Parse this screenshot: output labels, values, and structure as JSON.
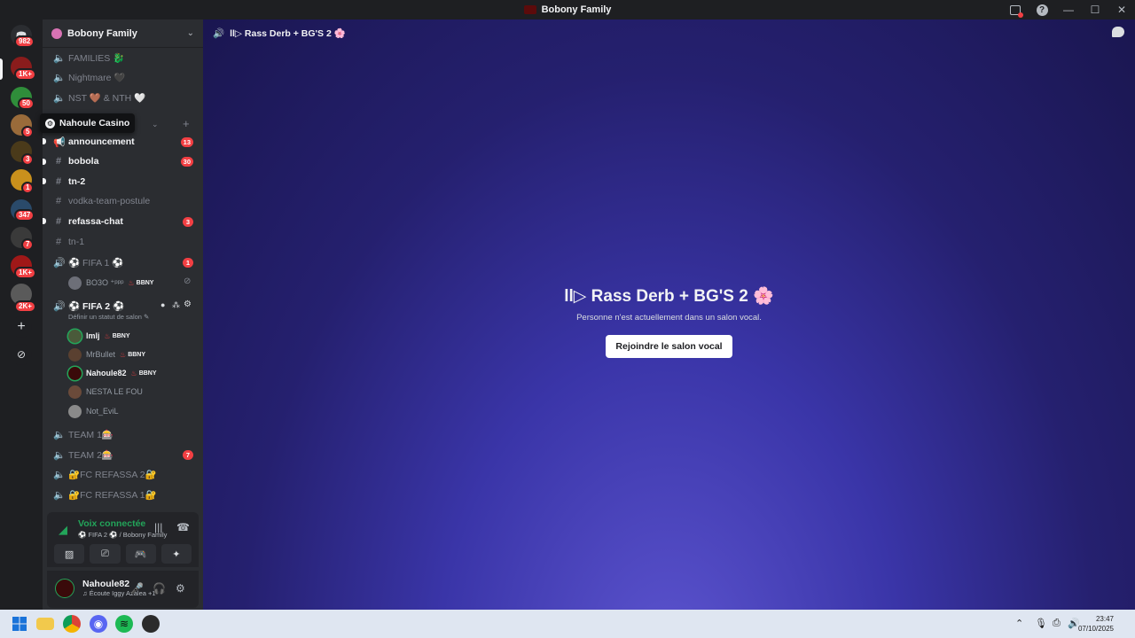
{
  "window": {
    "title": "Bobony Family"
  },
  "rail": {
    "home_badge": "982",
    "servers": [
      {
        "badge": "1K+",
        "color": "#8a1c1c"
      },
      {
        "badge": "50",
        "color": "#2f8d3a"
      },
      {
        "badge": "5",
        "color": "#9a6b3a"
      },
      {
        "badge": "3",
        "color": "#4a3a1a"
      },
      {
        "badge": "1",
        "color": "#c9901c"
      },
      {
        "badge": "347",
        "color": "#2a4a6a"
      },
      {
        "badge": "7",
        "color": "#3a3a3a"
      },
      {
        "badge": "1K+",
        "color": "#a01818"
      },
      {
        "badge": "2K+",
        "color": "#5a5a5a"
      }
    ]
  },
  "server": {
    "name": "Bobony Family"
  },
  "tooltip": {
    "label": "Nahoule Casino"
  },
  "channels": [
    {
      "type": "voice",
      "name": "FAMILIES 🐉",
      "unread": false,
      "badge": ""
    },
    {
      "type": "voice",
      "name": "Nightmare 🖤",
      "unread": false,
      "badge": ""
    },
    {
      "type": "voice",
      "name": "NST 🤎 & NTH 🤍",
      "unread": false,
      "badge": ""
    },
    {
      "type": "text",
      "name": "announcement",
      "unread": true,
      "badge": "13"
    },
    {
      "type": "text",
      "name": "bobola",
      "unread": true,
      "badge": "30"
    },
    {
      "type": "text",
      "name": "tn-2",
      "unread": true,
      "badge": ""
    },
    {
      "type": "text",
      "name": "vodka-team-postule",
      "unread": false,
      "badge": ""
    },
    {
      "type": "text",
      "name": "refassa-chat",
      "unread": true,
      "badge": "3"
    },
    {
      "type": "text",
      "name": "tn-1",
      "unread": false,
      "badge": ""
    },
    {
      "type": "voice",
      "name": "⚽ FIFA 1 ⚽",
      "unread": false,
      "badge": "1"
    },
    {
      "type": "voice",
      "name": "⚽ FIFA 2 ⚽",
      "unread": true,
      "badge": ""
    },
    {
      "type": "voice",
      "name": "TEAM 1🎰",
      "unread": false,
      "badge": ""
    },
    {
      "type": "voice",
      "name": "TEAM 2🎰",
      "unread": false,
      "badge": "7"
    },
    {
      "type": "voice",
      "name": "🔐FC REFASSA 2🔐",
      "unread": false,
      "badge": ""
    },
    {
      "type": "voice",
      "name": "🔐FC REFASSA 1🔐",
      "unread": false,
      "badge": ""
    }
  ],
  "fifa1_user": {
    "name": "BO3O ⁺ᵖᵖᵖ",
    "tag": "BBNY"
  },
  "fifa2": {
    "status_hint": "Définir un statut de salon ✎",
    "users": [
      {
        "name": "lmlj",
        "tag": "BBNY",
        "active": true
      },
      {
        "name": "MrBullet",
        "tag": "BBNY",
        "active": false
      },
      {
        "name": "Nahoule82",
        "tag": "BBNY",
        "active": true
      },
      {
        "name": "NESTA LE FOU",
        "tag": "",
        "active": false
      },
      {
        "name": "Not_EviL",
        "tag": "",
        "active": false
      }
    ]
  },
  "voice_panel": {
    "title": "Voix connectée",
    "subtitle": "⚽ FIFA 2 ⚽ / Bobony Family"
  },
  "user_panel": {
    "name": "Nahoule82",
    "status": "♫ Écoute Iggy Azalea +1"
  },
  "main": {
    "header_title": "ll▷ Rass Derb + BG'S 2 🌸",
    "title": "ll▷ Rass Derb + BG'S 2 🌸",
    "description": "Personne n'est actuellement dans un salon vocal.",
    "join_label": "Rejoindre le salon vocal"
  },
  "taskbar": {
    "time": "23:47",
    "date": "07/10/2025"
  },
  "colors": {
    "accent_green": "#23a55a",
    "badge_red": "#f23f43"
  }
}
